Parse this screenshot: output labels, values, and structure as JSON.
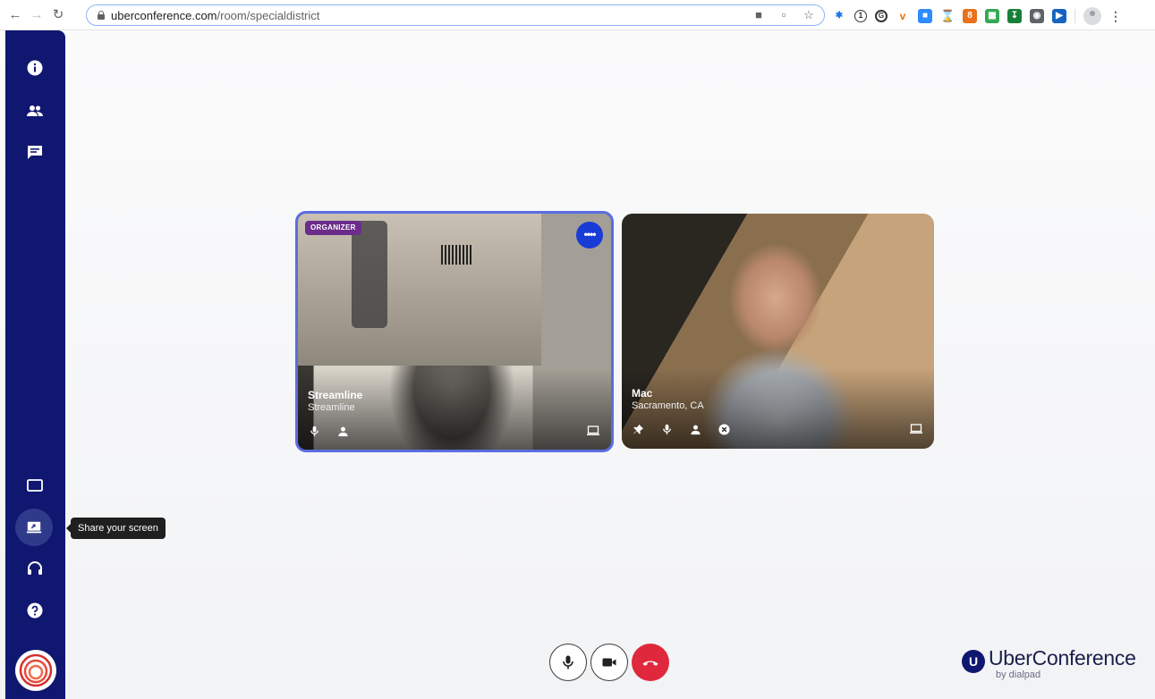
{
  "browser": {
    "url_host": "uberconference.com",
    "url_path": "/room/specialdistrict",
    "back_icon": "arrow-left",
    "forward_icon": "arrow-right",
    "reload_icon": "reload"
  },
  "sidebar": {
    "top_items": [
      {
        "name": "info",
        "icon": "info-icon"
      },
      {
        "name": "participants",
        "icon": "people-icon"
      },
      {
        "name": "chat",
        "icon": "chat-icon"
      }
    ],
    "bottom_items": [
      {
        "name": "layout",
        "icon": "screen-outline-icon"
      },
      {
        "name": "share-screen",
        "icon": "share-screen-icon",
        "active": true
      },
      {
        "name": "audio",
        "icon": "headset-icon"
      },
      {
        "name": "help",
        "icon": "help-icon"
      }
    ],
    "color": "#101770"
  },
  "tooltip": {
    "text": "Share your screen"
  },
  "tiles": [
    {
      "badge": "ORGANIZER",
      "name": "Streamline",
      "subtitle": "Streamline",
      "highlight_color": "#5b6de0",
      "more_label": "••••"
    },
    {
      "name": "Mac",
      "subtitle": "Sacramento, CA"
    }
  ],
  "controls": {
    "mic_icon": "microphone-icon",
    "camera_icon": "camera-icon",
    "end_call_icon": "phone-hangup-icon",
    "end_call_color": "#e0283c"
  },
  "branding": {
    "mark": "U",
    "name": "UberConference",
    "by": "by dialpad"
  }
}
